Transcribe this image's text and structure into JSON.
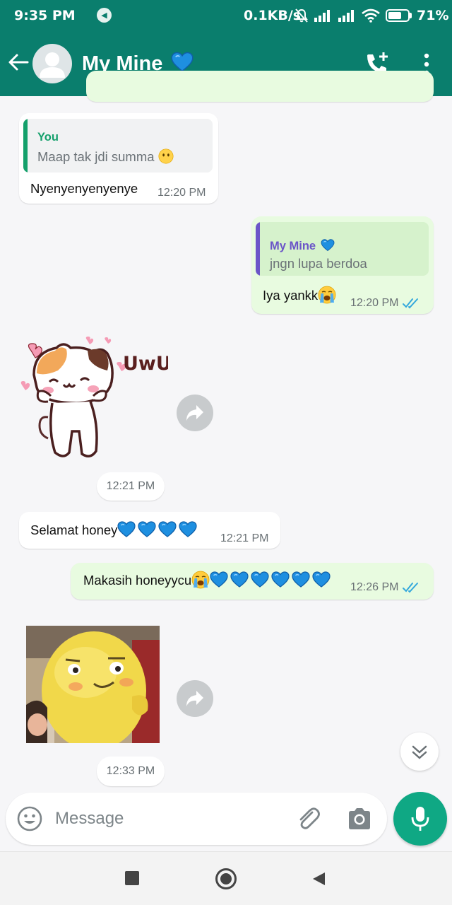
{
  "status_bar": {
    "time": "9:35 PM",
    "network_speed": "0.1KB/s",
    "battery_percent": "71%",
    "battery_level": 0.71,
    "icons": [
      "media-sound-icon",
      "mute-icon",
      "signal-icon",
      "signal-icon",
      "wifi-icon",
      "battery-icon"
    ]
  },
  "header": {
    "contact_name": "My Mine",
    "icons": [
      "back-arrow-icon",
      "avatar-icon",
      "blue-heart-icon",
      "add-call-icon",
      "more-options-icon"
    ]
  },
  "messages": [
    {
      "direction": "incoming",
      "quote_author": "You",
      "quote_text": "Maap tak jdi summa",
      "quote_emoji": "no-mouth-face-emoji",
      "text": "Nyenyenyenyenye",
      "time": "12:20 PM"
    },
    {
      "direction": "outgoing",
      "quote_author": "My Mine",
      "quote_author_emoji": "blue-heart-emoji",
      "quote_text": "jngn lupa berdoa",
      "text": "Iya yankk",
      "text_emoji": "loudly-crying-face-emoji",
      "time": "12:20 PM",
      "status": "read"
    },
    {
      "direction": "incoming",
      "type": "sticker",
      "sticker_text": "UwU",
      "time": "12:21 PM"
    },
    {
      "direction": "incoming",
      "text": "Selamat honey",
      "text_emoji_count": 4,
      "time": "12:21 PM"
    },
    {
      "direction": "outgoing",
      "text": "Makasih honeyycu",
      "text_emoji_count": 6,
      "time": "12:26 PM",
      "status": "read"
    },
    {
      "direction": "incoming",
      "type": "sticker",
      "time": "12:33 PM"
    }
  ],
  "composer": {
    "placeholder": "Message",
    "icons": [
      "emoji-icon",
      "attach-icon",
      "camera-icon",
      "mic-icon"
    ]
  },
  "navigation_bar": {
    "icons": [
      "recents-icon",
      "home-icon",
      "back-icon"
    ]
  },
  "colors": {
    "header": "#0a7e6d",
    "outgoing_bubble": "#e8fbe0",
    "incoming_bubble": "#ffffff",
    "quote_you": "#14a06b",
    "quote_contact": "#6b55c8",
    "read_ticks": "#34a8dc",
    "mic_button": "#0fa884"
  }
}
